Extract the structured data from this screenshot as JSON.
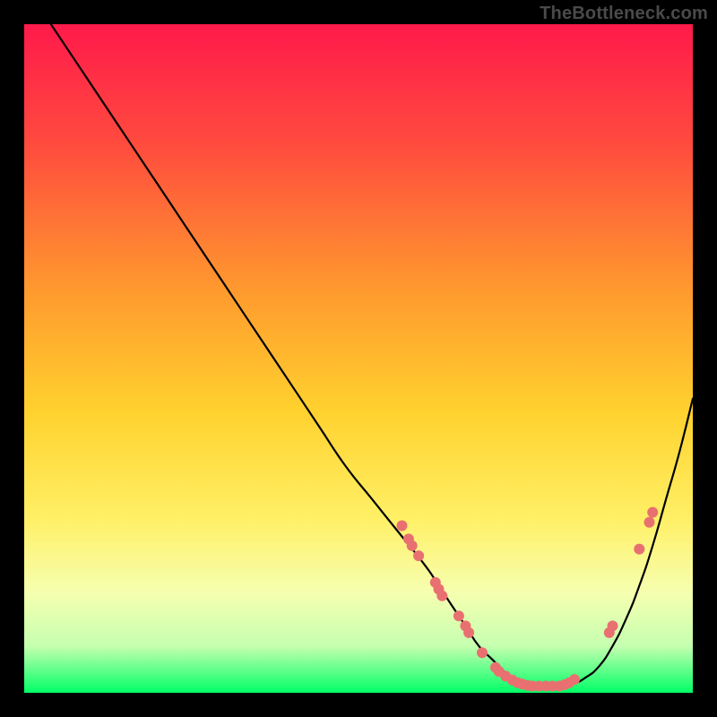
{
  "attribution": "TheBottleneck.com",
  "colors": {
    "dot": "#e97070",
    "curve": "#000000",
    "gradient_top": "#ff1a4b",
    "gradient_mid": "#ffd400",
    "gradient_bottom": "#00ff66",
    "frame_bg": "#000000"
  },
  "chart_data": {
    "type": "line",
    "title": "",
    "xlabel": "",
    "ylabel": "",
    "xlim": [
      0,
      100
    ],
    "ylim": [
      0,
      100
    ],
    "series": [
      {
        "name": "bottleneck-curve",
        "x": [
          4,
          8,
          12,
          16,
          20,
          24,
          28,
          32,
          36,
          40,
          44,
          48,
          52,
          56,
          60,
          62,
          64,
          66,
          68,
          70,
          72,
          74,
          76,
          78,
          80,
          82,
          84,
          86,
          88,
          90,
          92,
          94,
          96,
          98,
          100
        ],
        "y": [
          100,
          94,
          88,
          82,
          76,
          70,
          64,
          58,
          52,
          46,
          40,
          34,
          29,
          24,
          19,
          16,
          13,
          10,
          7,
          5,
          3,
          2,
          1.3,
          1,
          1,
          1.3,
          2.3,
          4,
          7,
          11,
          16,
          22,
          29,
          36,
          44
        ]
      }
    ],
    "markers": [
      {
        "x": 56.5,
        "y": 25
      },
      {
        "x": 57.5,
        "y": 23
      },
      {
        "x": 58.0,
        "y": 22
      },
      {
        "x": 59.0,
        "y": 20.5
      },
      {
        "x": 61.5,
        "y": 16.5
      },
      {
        "x": 62.0,
        "y": 15.5
      },
      {
        "x": 62.5,
        "y": 14.5
      },
      {
        "x": 65.0,
        "y": 11.5
      },
      {
        "x": 66.0,
        "y": 10.0
      },
      {
        "x": 66.5,
        "y": 9.0
      },
      {
        "x": 68.5,
        "y": 6.0
      },
      {
        "x": 70.5,
        "y": 3.8
      },
      {
        "x": 71.0,
        "y": 3.2
      },
      {
        "x": 72.0,
        "y": 2.5
      },
      {
        "x": 73.0,
        "y": 1.9
      },
      {
        "x": 73.8,
        "y": 1.5
      },
      {
        "x": 74.5,
        "y": 1.3
      },
      {
        "x": 75.3,
        "y": 1.1
      },
      {
        "x": 76.0,
        "y": 1.0
      },
      {
        "x": 77.0,
        "y": 1.0
      },
      {
        "x": 78.0,
        "y": 1.0
      },
      {
        "x": 79.0,
        "y": 1.0
      },
      {
        "x": 80.0,
        "y": 1.0
      },
      {
        "x": 80.8,
        "y": 1.2
      },
      {
        "x": 81.5,
        "y": 1.5
      },
      {
        "x": 82.3,
        "y": 2.0
      },
      {
        "x": 87.5,
        "y": 9.0
      },
      {
        "x": 88.0,
        "y": 10.0
      },
      {
        "x": 92.0,
        "y": 21.5
      },
      {
        "x": 93.5,
        "y": 25.5
      },
      {
        "x": 94.0,
        "y": 27.0
      }
    ]
  }
}
